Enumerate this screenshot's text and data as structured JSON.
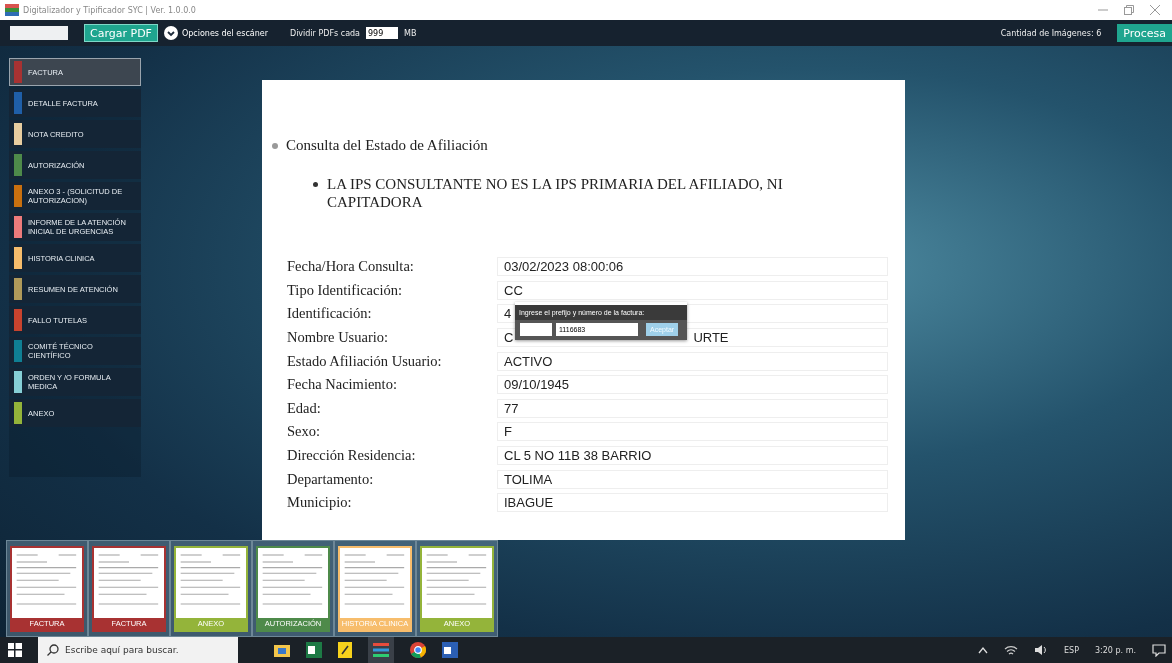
{
  "window": {
    "title": "Digitalizador y Tipificador SYC | Ver. 1.0.0.0"
  },
  "toolbar": {
    "load_button": "Cargar PDF",
    "scanner_options": "Opciones del escáner",
    "split_label": "Dividir PDFs cada",
    "split_value": "999",
    "split_unit": "MB",
    "image_count": "Cantidad de Imágenes: 6",
    "process_button": "Procesa"
  },
  "sidebar": {
    "items": [
      {
        "label": "FACTURA",
        "color": "#a83232",
        "selected": true
      },
      {
        "label": "DETALLE FACTURA",
        "color": "#1f5fa8",
        "selected": false
      },
      {
        "label": "NOTA CREDITO",
        "color": "#e8cda0",
        "selected": false
      },
      {
        "label": "AUTORIZACIÓN",
        "color": "#4e8a4a",
        "selected": false
      },
      {
        "label": "ANEXO 3 - (SOLICITUD DE AUTORIZACION)",
        "color": "#c9700f",
        "selected": false
      },
      {
        "label": "INFORME DE LA ATENCIÓN INICIAL DE URGENCIAS",
        "color": "#ee7b7b",
        "selected": false
      },
      {
        "label": "HISTORIA CLINICA",
        "color": "#f7bd6c",
        "selected": false
      },
      {
        "label": "RESUMEN DE ATENCIÓN",
        "color": "#b09a5a",
        "selected": false
      },
      {
        "label": "FALLO TUTELAS",
        "color": "#c8432e",
        "selected": false
      },
      {
        "label": "COMITÉ TÉCNICO CIENTÍFICO",
        "color": "#0f7f94",
        "selected": false
      },
      {
        "label": "ORDEN Y /O FORMULA MEDICA",
        "color": "#86cfd6",
        "selected": false
      },
      {
        "label": "ANEXO",
        "color": "#94b43a",
        "selected": false
      }
    ]
  },
  "document": {
    "heading": "Consulta del Estado de Afiliación",
    "notice": "LA IPS CONSULTANTE NO ES LA IPS PRIMARIA DEL AFILIADO, NI CAPITADORA",
    "rows": [
      {
        "label": "Fecha/Hora Consulta:",
        "value": "03/02/2023 08:00:06"
      },
      {
        "label": "Tipo Identificación:",
        "value": "CC"
      },
      {
        "label": "Identificación:",
        "value": "4"
      },
      {
        "label": "Nombre Usuario:",
        "value": "C",
        "value_end": "URTE"
      },
      {
        "label": "Estado Afiliación Usuario:",
        "value": "ACTIVO"
      },
      {
        "label": "Fecha Nacimiento:",
        "value": "09/10/1945"
      },
      {
        "label": "Edad:",
        "value": "77"
      },
      {
        "label": "Sexo:",
        "value": "F"
      },
      {
        "label": "Dirección Residencia:",
        "value": "CL 5 NO 11B 38 BARRIO"
      },
      {
        "label": "Departamento:",
        "value": "TOLIMA"
      },
      {
        "label": "Municipio:",
        "value": "IBAGUE"
      }
    ]
  },
  "dialog": {
    "prompt": "Ingrese el prefijo y número de la factura:",
    "number_value": "1116683",
    "accept_button": "Aceptar"
  },
  "thumbnails": [
    {
      "label": "FACTURA",
      "color": "#a83232"
    },
    {
      "label": "FACTURA",
      "color": "#a83232"
    },
    {
      "label": "ANEXO",
      "color": "#94b43a"
    },
    {
      "label": "AUTORIZACIÓN",
      "color": "#4e8a4a"
    },
    {
      "label": "HISTORIA CLINICA",
      "color": "#f7bd6c"
    },
    {
      "label": "ANEXO",
      "color": "#94b43a"
    }
  ],
  "taskbar": {
    "search_placeholder": "Escribe aquí para buscar.",
    "language": "ESP",
    "time": "3:20 p. m."
  }
}
